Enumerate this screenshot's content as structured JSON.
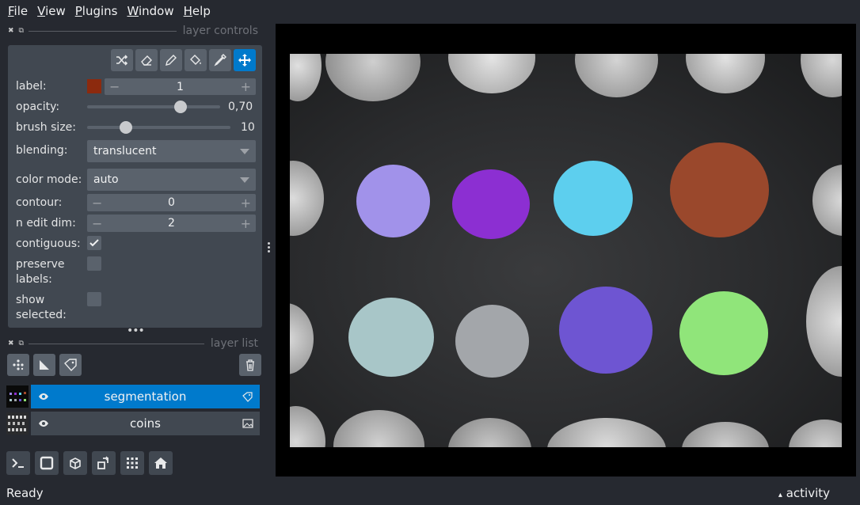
{
  "menu": [
    {
      "label": "File",
      "u": "F",
      "rest": "ile"
    },
    {
      "label": "View",
      "u": "V",
      "rest": "iew"
    },
    {
      "label": "Plugins",
      "u": "P",
      "rest": "lugins"
    },
    {
      "label": "Window",
      "u": "W",
      "rest": "indow"
    },
    {
      "label": "Help",
      "u": "H",
      "rest": "elp"
    }
  ],
  "layer_controls": {
    "title": "layer controls",
    "tools": [
      "shuffle-icon",
      "erase-icon",
      "paint-icon",
      "fill-icon",
      "pick-icon",
      "pan-zoom-icon"
    ],
    "active_tool": "pan-zoom-icon",
    "label": {
      "text": "label:",
      "value": "1",
      "color": "#8c2a0e"
    },
    "opacity": {
      "text": "opacity:",
      "value": "0,70",
      "fraction": 0.7
    },
    "brush_size": {
      "text": "brush size:",
      "value": "10",
      "fraction": 0.27
    },
    "blending": {
      "text": "blending:",
      "value": "translucent"
    },
    "color_mode": {
      "text": "color mode:",
      "value": "auto"
    },
    "contour": {
      "text": "contour:",
      "value": "0"
    },
    "n_edit_dim": {
      "text": "n edit dim:",
      "value": "2"
    },
    "contiguous": {
      "text": "contiguous:",
      "checked": true
    },
    "preserve_labels": {
      "text": "preserve labels:",
      "checked": false
    },
    "show_selected": {
      "text": "show selected:",
      "checked": false
    }
  },
  "layer_list": {
    "title": "layer list",
    "layers": [
      {
        "name": "segmentation",
        "selected": true,
        "type_icon": "labels-icon"
      },
      {
        "name": "coins",
        "selected": false,
        "type_icon": "image-icon"
      }
    ]
  },
  "status": {
    "text": "Ready",
    "activity": "activity"
  }
}
